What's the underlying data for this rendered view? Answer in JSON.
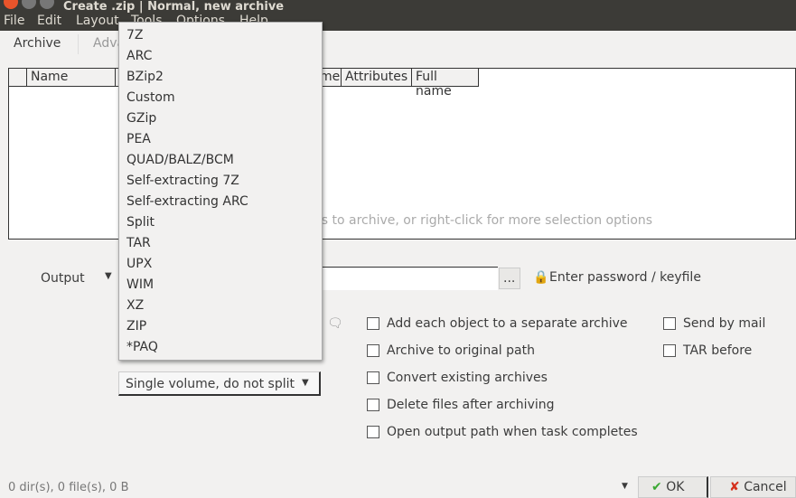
{
  "window": {
    "title": "Create .zip | Normal, new archive"
  },
  "menu": [
    "File",
    "Edit",
    "Layout",
    "Tools",
    "Options",
    "Help"
  ],
  "tabs": [
    "Archive",
    "Adva"
  ],
  "table": {
    "columns": [
      "Name",
      "T",
      "me",
      "Attributes",
      "Full name"
    ],
    "empty_hint": "rs to archive, or right-click for more selection options"
  },
  "output": {
    "label": "Output",
    "browse": "...",
    "password": "Enter password / keyfile"
  },
  "format_options": [
    "7Z",
    "ARC",
    "BZip2",
    "Custom",
    "GZip",
    "PEA",
    "QUAD/BALZ/BCM",
    "Self-extracting 7Z",
    "Self-extracting ARC",
    "Split",
    "TAR",
    "UPX",
    "WIM",
    "XZ",
    "ZIP",
    "*PAQ"
  ],
  "split": {
    "value": "Single volume, do not split"
  },
  "options": [
    {
      "label": "Add each object to a separate archive",
      "checked": false
    },
    {
      "label": "Archive to original path",
      "checked": false
    },
    {
      "label": "Convert existing archives",
      "checked": false
    },
    {
      "label": "Delete files after archiving",
      "checked": false
    },
    {
      "label": "Open output path when task completes",
      "checked": false
    }
  ],
  "options2": [
    {
      "label": "Send by mail",
      "checked": false
    },
    {
      "label": "TAR before",
      "checked": false
    }
  ],
  "status": "0 dir(s), 0 file(s), 0 B",
  "buttons": {
    "ok": "OK",
    "cancel": "Cancel"
  },
  "colors": {
    "ok": "#3aa832",
    "cancel": "#d5301c"
  }
}
